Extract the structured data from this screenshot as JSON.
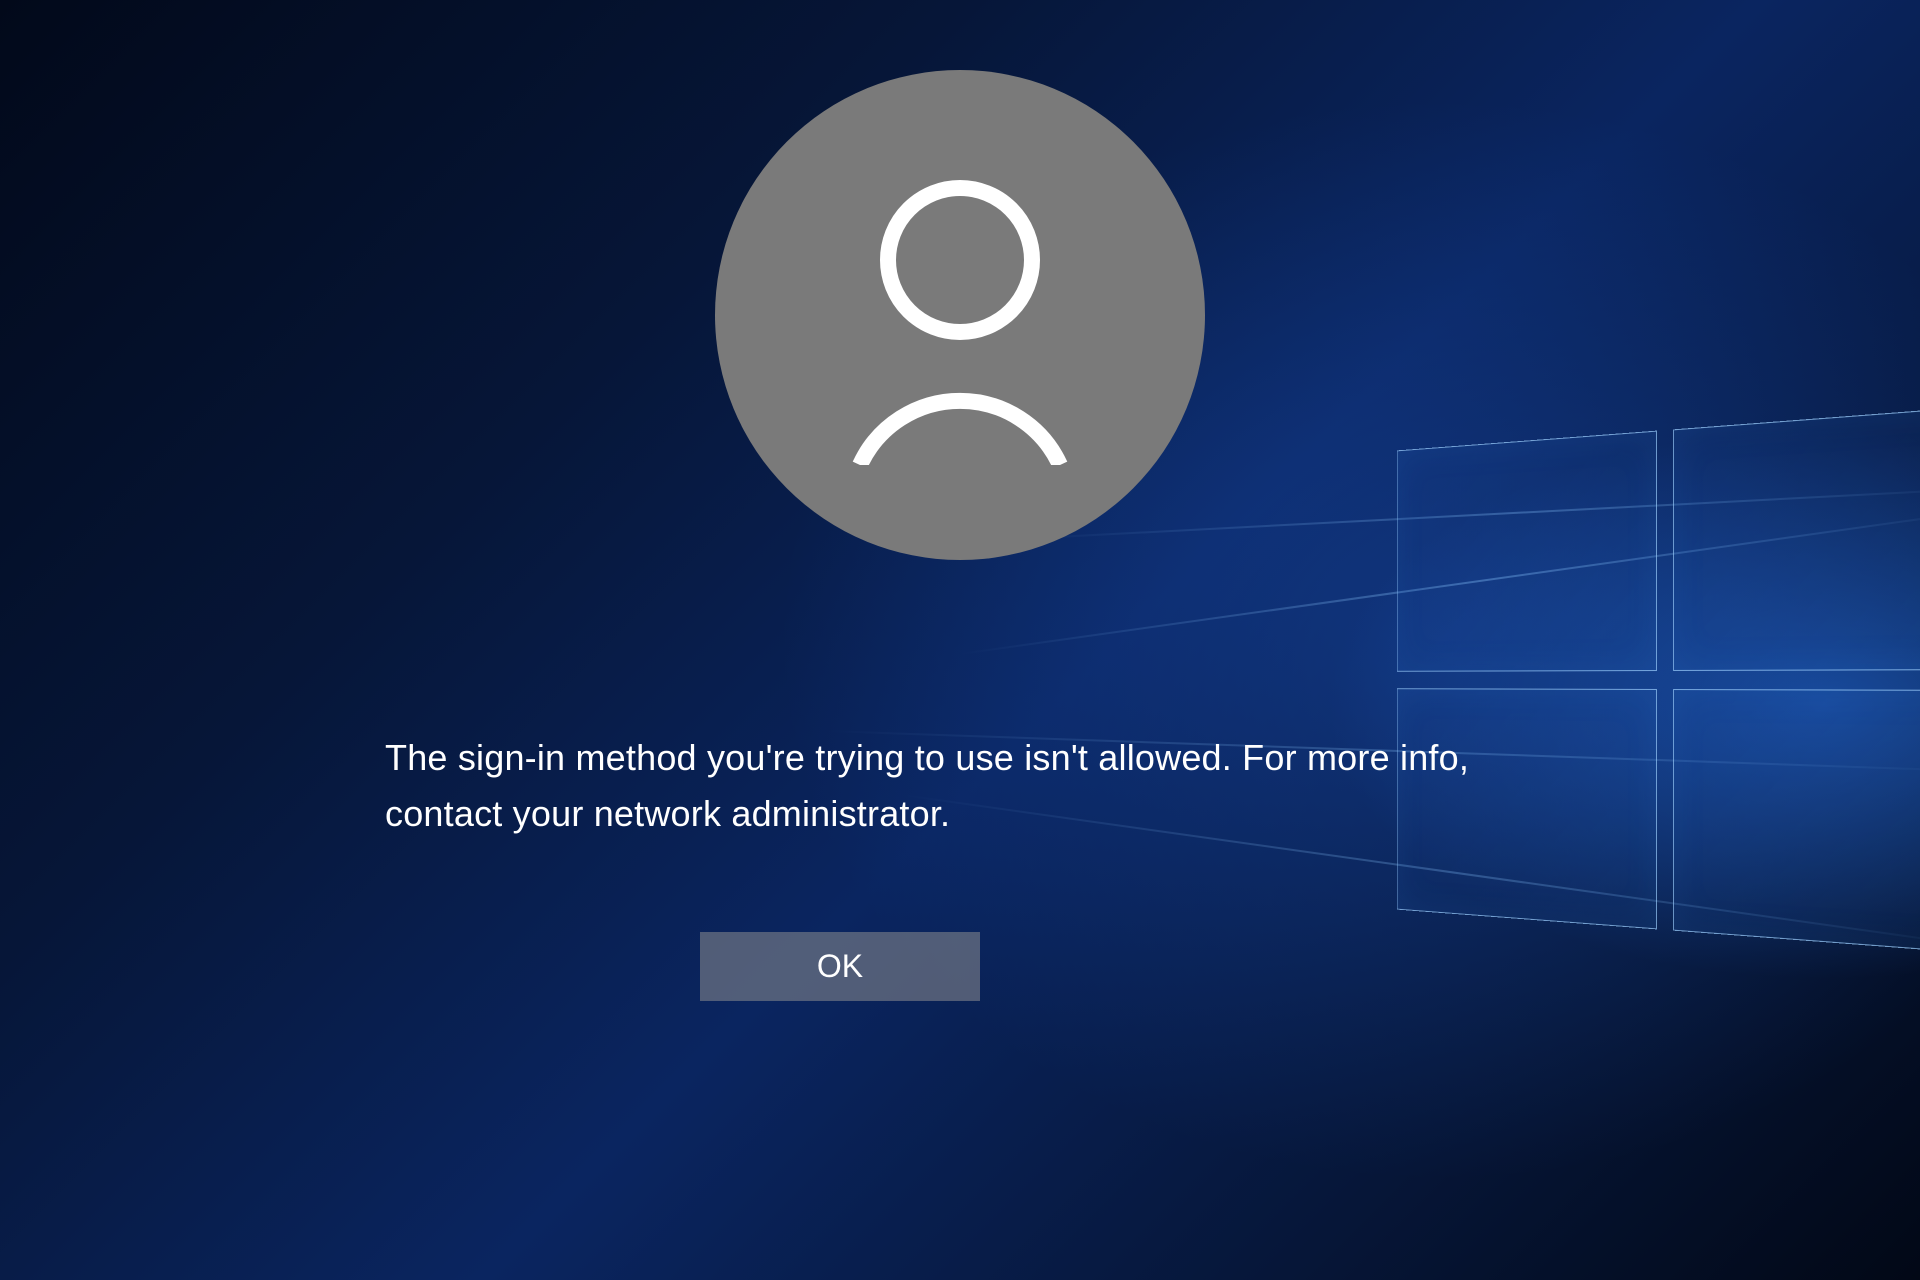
{
  "login": {
    "avatar_icon": "user-icon",
    "error_message": "The sign-in method you're trying to use isn't allowed. For more info, contact your network administrator.",
    "ok_label": "OK"
  },
  "colors": {
    "avatar_bg": "#7a7a7a",
    "button_bg": "rgba(120,125,135,0.65)",
    "text": "#ffffff"
  }
}
